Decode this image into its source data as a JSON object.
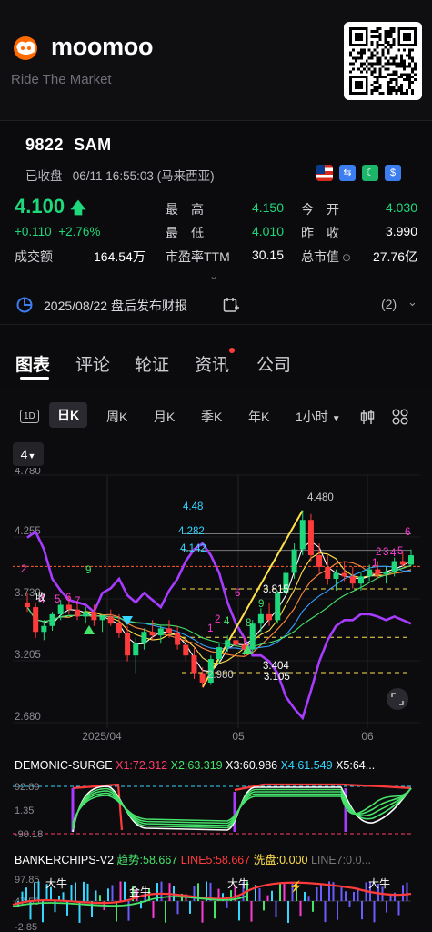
{
  "brand": {
    "name": "moomoo",
    "tagline": "Ride The Market"
  },
  "stock": {
    "code": "9822",
    "name": "SAM",
    "status": "已收盘",
    "datetime": "06/11 16:55:03 (马来西亚)",
    "price": "4.100",
    "change": "+0.110",
    "change_pct": "+2.76%",
    "turnover_label": "成交额",
    "turnover_value": "164.54万",
    "quote": [
      {
        "label": "最　高",
        "value": "4.150",
        "color": "#1fd87c"
      },
      {
        "label": "今　开",
        "value": "4.030",
        "color": "#1fd87c"
      },
      {
        "label": "最　低",
        "value": "4.010",
        "color": "#1fd87c"
      },
      {
        "label": "昨　收",
        "value": "3.990",
        "color": "#ffffff"
      },
      {
        "label": "市盈率TTM",
        "value": "30.15",
        "color": "#ffffff"
      },
      {
        "label": "总市值",
        "value": "27.76亿",
        "color": "#ffffff"
      }
    ],
    "report_notice": "2025/08/22 盘后发布财报",
    "report_count": "(2)"
  },
  "tabs": [
    {
      "label": "图表",
      "active": true
    },
    {
      "label": "评论",
      "active": false
    },
    {
      "label": "轮证",
      "active": false
    },
    {
      "label": "资讯",
      "active": false
    },
    {
      "label": "公司",
      "active": false
    }
  ],
  "periods": [
    {
      "label": "1D"
    },
    {
      "label": "日K",
      "active": true
    },
    {
      "label": "周K"
    },
    {
      "label": "月K"
    },
    {
      "label": "季K"
    },
    {
      "label": "年K"
    },
    {
      "label": "1小时"
    }
  ],
  "overlay_selector": "4",
  "chart_data": {
    "type": "candlestick",
    "y_ticks": [
      "4.780",
      "4.255",
      "3.730",
      "3.205",
      "2.680"
    ],
    "ylim": [
      2.68,
      4.78
    ],
    "x_ticks": [
      "2025/04",
      "05",
      "06"
    ],
    "price_annotations": [
      "4.48",
      "4.282",
      "4.142",
      "3.815",
      "3.404",
      "3.105",
      "4.480",
      "2.980"
    ],
    "candles": [
      [
        3.7,
        3.78,
        3.62,
        3.66
      ],
      [
        3.66,
        3.7,
        3.4,
        3.45
      ],
      [
        3.45,
        3.55,
        3.38,
        3.5
      ],
      [
        3.5,
        3.62,
        3.46,
        3.6
      ],
      [
        3.6,
        3.72,
        3.55,
        3.68
      ],
      [
        3.68,
        3.75,
        3.6,
        3.64
      ],
      [
        3.64,
        3.7,
        3.55,
        3.58
      ],
      [
        3.58,
        3.66,
        3.52,
        3.62
      ],
      [
        3.62,
        3.68,
        3.5,
        3.55
      ],
      [
        3.55,
        3.6,
        3.45,
        3.58
      ],
      [
        3.58,
        3.64,
        3.5,
        3.52
      ],
      [
        3.52,
        3.6,
        3.4,
        3.44
      ],
      [
        3.44,
        3.5,
        3.2,
        3.25
      ],
      [
        3.25,
        3.4,
        3.1,
        3.35
      ],
      [
        3.35,
        3.48,
        3.3,
        3.45
      ],
      [
        3.45,
        3.55,
        3.38,
        3.42
      ],
      [
        3.42,
        3.5,
        3.35,
        3.48
      ],
      [
        3.48,
        3.55,
        3.4,
        3.44
      ],
      [
        3.44,
        3.5,
        3.3,
        3.34
      ],
      [
        3.34,
        3.4,
        3.2,
        3.25
      ],
      [
        3.25,
        3.32,
        3.05,
        3.1
      ],
      [
        3.1,
        3.15,
        2.98,
        3.02
      ],
      [
        3.02,
        3.25,
        3.0,
        3.22
      ],
      [
        3.22,
        3.35,
        3.18,
        3.32
      ],
      [
        3.32,
        3.42,
        3.28,
        3.38
      ],
      [
        3.38,
        3.45,
        3.3,
        3.34
      ],
      [
        3.34,
        3.4,
        3.25,
        3.3
      ],
      [
        3.3,
        3.55,
        3.28,
        3.52
      ],
      [
        3.52,
        3.65,
        3.45,
        3.6
      ],
      [
        3.6,
        3.7,
        3.5,
        3.55
      ],
      [
        3.55,
        3.8,
        3.52,
        3.78
      ],
      [
        3.78,
        4.0,
        3.75,
        3.95
      ],
      [
        3.95,
        4.2,
        3.9,
        4.15
      ],
      [
        4.15,
        4.48,
        4.1,
        4.4
      ],
      [
        4.4,
        4.45,
        4.05,
        4.1
      ],
      [
        4.1,
        4.2,
        3.95,
        4.0
      ],
      [
        4.0,
        4.1,
        3.85,
        3.9
      ],
      [
        3.9,
        3.98,
        3.8,
        3.95
      ],
      [
        3.95,
        4.05,
        3.88,
        3.92
      ],
      [
        3.92,
        4.0,
        3.82,
        3.86
      ],
      [
        3.86,
        3.95,
        3.8,
        3.92
      ],
      [
        3.92,
        4.02,
        3.88,
        3.98
      ],
      [
        3.98,
        4.05,
        3.9,
        3.94
      ],
      [
        3.94,
        4.0,
        3.86,
        3.96
      ],
      [
        3.96,
        4.08,
        3.92,
        4.05
      ],
      [
        4.05,
        4.12,
        4.0,
        4.02
      ],
      [
        4.02,
        4.15,
        4.01,
        4.1
      ]
    ]
  },
  "indicator1": {
    "name": "DEMONIC-SURGE",
    "values": [
      "X1:72.312",
      "X2:63.319",
      "X3:60.986",
      "X4:61.549",
      "X5:64..."
    ],
    "colors": [
      "#ff3b6b",
      "#46e36b",
      "#ffffff",
      "#35d6ff",
      "#ffffff"
    ],
    "y_ticks": [
      "92.89",
      "1.35",
      "-90.18"
    ]
  },
  "indicator2": {
    "name": "BANKERCHIPS-V2",
    "values": [
      "趋势:58.667",
      "LINE5:58.667",
      "洗盘:0.000",
      "LINE7:0.0..."
    ],
    "colors": [
      "#46e36b",
      "#ff3b3b",
      "#ffe14a",
      "#777"
    ],
    "y_ticks": [
      "97.85",
      "47.50",
      "-2.85"
    ],
    "labels": [
      "大牛",
      "金牛",
      "大牛",
      "大牛"
    ]
  }
}
